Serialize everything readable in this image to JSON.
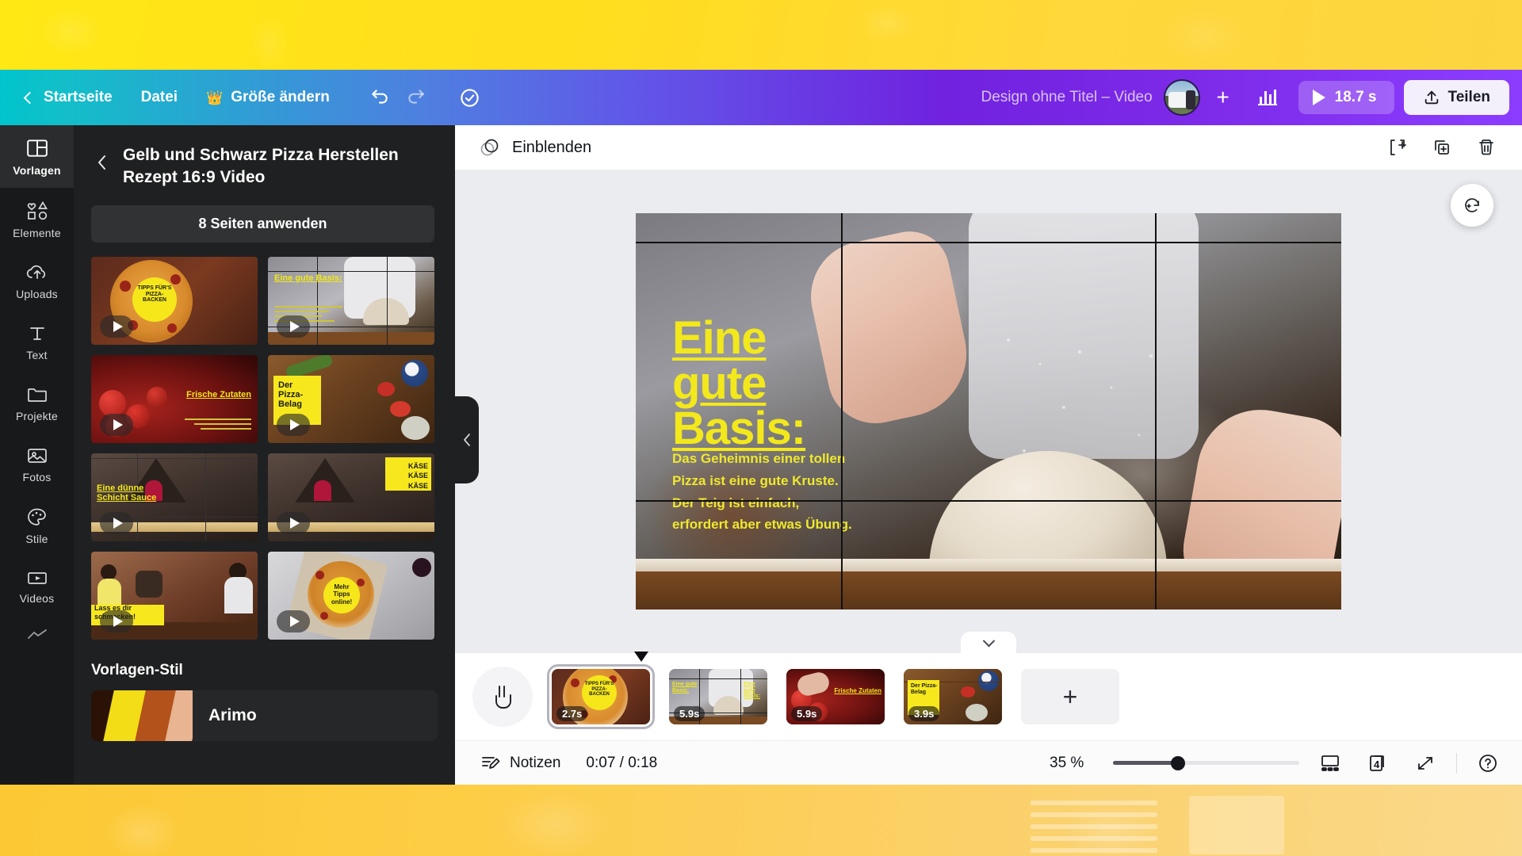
{
  "topbar": {
    "back_icon": "chevron-left-icon",
    "home_label": "Startseite",
    "file_label": "Datei",
    "crown_icon": "crown-icon",
    "resize_label": "Größe ändern",
    "undo_icon": "undo-icon",
    "redo_icon": "redo-icon",
    "cloud_saved_icon": "cloud-check-icon",
    "doc_title": "Design ohne Titel – Video",
    "avatar_name": "avatar",
    "add_member_icon": "plus-icon",
    "insights_icon": "bar-chart-icon",
    "play_icon": "play-icon",
    "duration": "18.7 s",
    "share_icon": "upload-icon",
    "share_label": "Teilen"
  },
  "rail": {
    "items": [
      {
        "label": "Vorlagen",
        "icon": "layout-template-icon",
        "active": true
      },
      {
        "label": "Elemente",
        "icon": "shapes-icon",
        "active": false
      },
      {
        "label": "Uploads",
        "icon": "cloud-upload-icon",
        "active": false
      },
      {
        "label": "Text",
        "icon": "text-icon",
        "active": false
      },
      {
        "label": "Projekte",
        "icon": "folder-icon",
        "active": false
      },
      {
        "label": "Fotos",
        "icon": "photo-icon",
        "active": false
      },
      {
        "label": "Stile",
        "icon": "palette-icon",
        "active": false
      },
      {
        "label": "Videos",
        "icon": "video-icon",
        "active": false
      },
      {
        "label": "",
        "icon": "trend-line-icon",
        "active": false
      }
    ]
  },
  "panel": {
    "back_icon": "chevron-left-icon",
    "title": "Gelb und Schwarz Pizza Herstellen Rezept 16:9 Video",
    "apply_label": "8 Seiten anwenden",
    "thumbnails": [
      {
        "caption": "TIPPS FÜR'S PIZZA-BACKEN",
        "kind": "pizza-circle"
      },
      {
        "caption": "Eine gute Basis:",
        "kind": "dough-hands"
      },
      {
        "caption": "Frische Zutaten",
        "kind": "tomatoes"
      },
      {
        "caption": "Der Pizza-Belag",
        "kind": "toppings"
      },
      {
        "caption": "Eine dünne Schicht Sauce",
        "kind": "oven"
      },
      {
        "caption": "KÄSE KÄSE KÄSE",
        "kind": "oven-cheese"
      },
      {
        "caption": "Lass es dir schmecken!",
        "kind": "friends"
      },
      {
        "caption": "Mehr Tipps online!",
        "kind": "pizza-box"
      }
    ],
    "style_heading": "Vorlagen-Stil",
    "style_font": "Arimo",
    "style_colors": [
      "#2b1206",
      "#f2dd16",
      "#b4521c",
      "#e8b492"
    ],
    "collapse_icon": "chevron-left-icon"
  },
  "editor": {
    "effect_icon": "pages-stack-icon",
    "effect_label": "Einblenden",
    "add_page_icon": "add-page-icon",
    "duplicate_page_icon": "duplicate-page-icon",
    "delete_page_icon": "trash-icon",
    "magic_icon": "magic-wand-icon",
    "collapse_timeline_icon": "chevron-down-icon"
  },
  "canvas": {
    "heading_lines": [
      "Eine",
      "gute",
      "Basis:"
    ],
    "body_lines": [
      "Das Geheimnis einer tollen",
      "Pizza ist eine gute Kruste.",
      "Der Teig ist einfach,",
      "erfordert aber etwas Übung."
    ],
    "heading_color": "#f2e81c",
    "body_color": "#efe82f"
  },
  "timeline": {
    "pan_tool_icon": "hand-icon",
    "add_page_label": "+",
    "clips": [
      {
        "duration": "2.7s",
        "caption": "TIPPS FÜR'S PIZZA-BACKEN",
        "kind": "pizza-circle",
        "selected": true
      },
      {
        "duration": "5.9s",
        "caption": "Eine gute Basis:",
        "kind": "dough-hands",
        "selected": false
      },
      {
        "duration": "5.9s",
        "caption": "Frische Zutaten",
        "kind": "tomatoes",
        "selected": false
      },
      {
        "duration": "3.9s",
        "caption": "Der Pizza-Belag",
        "kind": "toppings",
        "selected": false
      }
    ]
  },
  "statusbar": {
    "notes_icon": "notes-icon",
    "notes_label": "Notizen",
    "timecode": "0:07 / 0:18",
    "zoom_level": "35 %",
    "zoom_slider_value": 35,
    "view_grid_icon": "presentation-icon",
    "page_count": "4",
    "page_count_icon": "pages-icon",
    "fullscreen_icon": "expand-icon",
    "help_icon": "help-icon"
  }
}
